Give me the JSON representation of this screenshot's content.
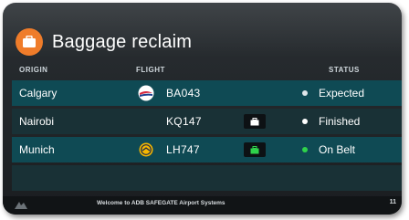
{
  "header": {
    "title": "Baggage reclaim",
    "icon": "suitcase-icon",
    "icon_color": "#ef7c2a"
  },
  "columns": {
    "origin": "ORIGIN",
    "flight": "FLIGHT",
    "status": "STATUS"
  },
  "rows": [
    {
      "origin": "Calgary",
      "airline_icon": "airline-logo-icon",
      "flight": "BA043",
      "bag_icon": "",
      "status": "Expected",
      "status_color": "#dfe6ea"
    },
    {
      "origin": "Nairobi",
      "airline_icon": "",
      "flight": "KQ147",
      "bag_icon": "suitcase-icon",
      "status": "Finished",
      "status_color": "#ffffff"
    },
    {
      "origin": "Munich",
      "airline_icon": "airline-logo-icon",
      "flight": "LH747",
      "bag_icon": "suitcase-icon",
      "status": "On Belt",
      "status_color": "#2fd24b"
    }
  ],
  "footer": {
    "ticker": "Welcome to ADB SAFEGATE Airport Systems",
    "time": "11"
  },
  "colors": {
    "row_dark": "#0f4a54",
    "row_alt": "#193136",
    "belt_green": "#2fd24b"
  }
}
